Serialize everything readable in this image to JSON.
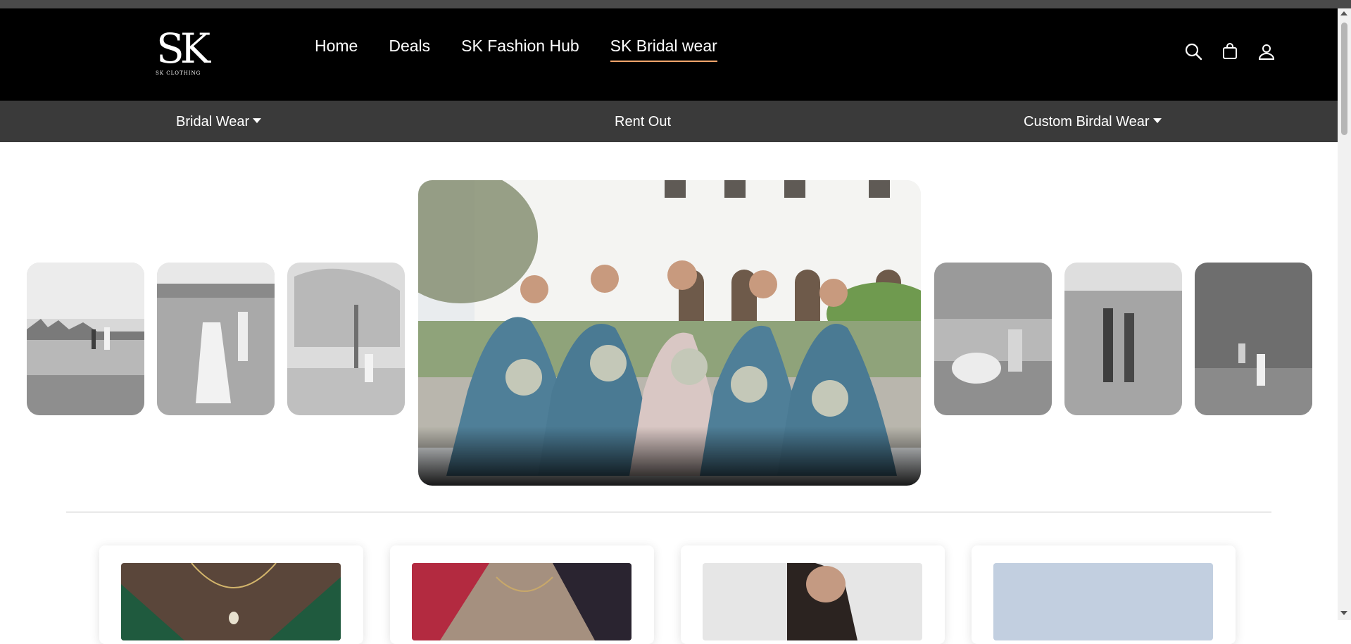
{
  "brand": {
    "logo_text": "SK",
    "logo_subtext": "SK CLOTHING"
  },
  "nav": {
    "items": [
      {
        "label": "Home",
        "active": false
      },
      {
        "label": "Deals",
        "active": false
      },
      {
        "label": "SK Fashion Hub",
        "active": false
      },
      {
        "label": "SK Bridal wear",
        "active": true
      }
    ]
  },
  "header_icons": [
    "search-icon",
    "shopping-bag-icon",
    "user-icon"
  ],
  "subnav": {
    "items": [
      {
        "label": "Bridal Wear",
        "has_dropdown": true
      },
      {
        "label": "Rent Out",
        "has_dropdown": false
      },
      {
        "label": "Custom Birdal Wear",
        "has_dropdown": true
      }
    ]
  },
  "carousel": {
    "left_thumbnails": [
      "couple-lake-photo",
      "couple-field-photo",
      "bride-tree-photo"
    ],
    "featured": "bridal-party-photo",
    "right_thumbnails": [
      "couple-seated-photo",
      "couple-standing-photo",
      "couple-jumping-photo"
    ]
  },
  "products": [
    "green-saree-product",
    "red-saree-product",
    "grey-gown-product",
    "blue-dress-product"
  ],
  "colors": {
    "header_bg": "#000000",
    "subnav_bg": "#3a3a3a",
    "active_underline": "#f0a46b"
  }
}
